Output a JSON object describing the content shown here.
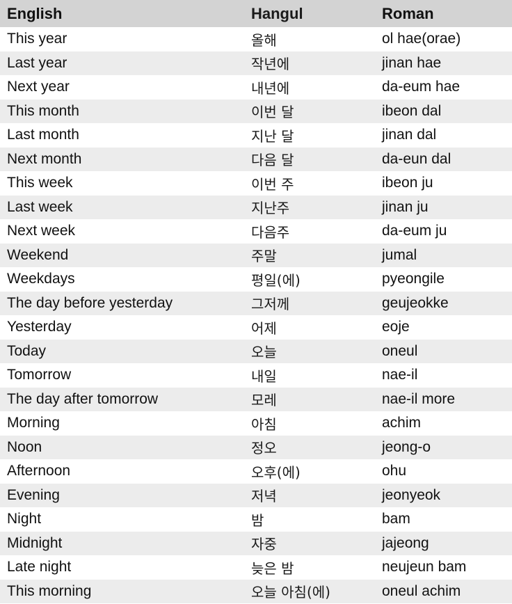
{
  "table": {
    "headers": {
      "english": "English",
      "hangul": "Hangul",
      "roman": "Roman"
    },
    "rows": [
      {
        "english": "This year",
        "hangul": "올해",
        "roman": "ol hae(orae)"
      },
      {
        "english": "Last year",
        "hangul": "작년에",
        "roman": "jinan hae"
      },
      {
        "english": "Next year",
        "hangul": "내년에",
        "roman": "da-eum hae"
      },
      {
        "english": "This month",
        "hangul": "이번 달",
        "roman": "ibeon dal"
      },
      {
        "english": "Last month",
        "hangul": "지난 달",
        "roman": "jinan dal"
      },
      {
        "english": "Next month",
        "hangul": "다음 달",
        "roman": "da-eun dal"
      },
      {
        "english": "This week",
        "hangul": "이번 주",
        "roman": "ibeon ju"
      },
      {
        "english": "Last week",
        "hangul": "지난주",
        "roman": "jinan ju"
      },
      {
        "english": "Next week",
        "hangul": "다음주",
        "roman": "da-eum ju"
      },
      {
        "english": "Weekend",
        "hangul": "주말",
        "roman": "jumal"
      },
      {
        "english": "Weekdays",
        "hangul": "평일(에)",
        "roman": "pyeongile"
      },
      {
        "english": "The day before yesterday",
        "hangul": "그저께",
        "roman": "geujeokke"
      },
      {
        "english": "Yesterday",
        "hangul": "어제",
        "roman": "eoje"
      },
      {
        "english": "Today",
        "hangul": "오늘",
        "roman": "oneul"
      },
      {
        "english": "Tomorrow",
        "hangul": "내일",
        "roman": "nae-il"
      },
      {
        "english": "The day after tomorrow",
        "hangul": "모레",
        "roman": "nae-il more"
      },
      {
        "english": "Morning",
        "hangul": "아침",
        "roman": "achim"
      },
      {
        "english": "Noon",
        "hangul": "정오",
        "roman": "jeong-o"
      },
      {
        "english": "Afternoon",
        "hangul": "오후(에)",
        "roman": "ohu"
      },
      {
        "english": "Evening",
        "hangul": "저녁",
        "roman": "jeonyeok"
      },
      {
        "english": "Night",
        "hangul": "밤",
        "roman": "bam"
      },
      {
        "english": "Midnight",
        "hangul": "자중",
        "roman": "jajeong"
      },
      {
        "english": "Late night",
        "hangul": "늦은 밤",
        "roman": "neujeun bam"
      },
      {
        "english": "This morning",
        "hangul": "오늘 아침(에)",
        "roman": "oneul achim"
      }
    ]
  },
  "colors": {
    "header_bg": "#d3d3d3",
    "row_odd_bg": "#ffffff",
    "row_even_bg": "#ececec",
    "text": "#111111"
  }
}
